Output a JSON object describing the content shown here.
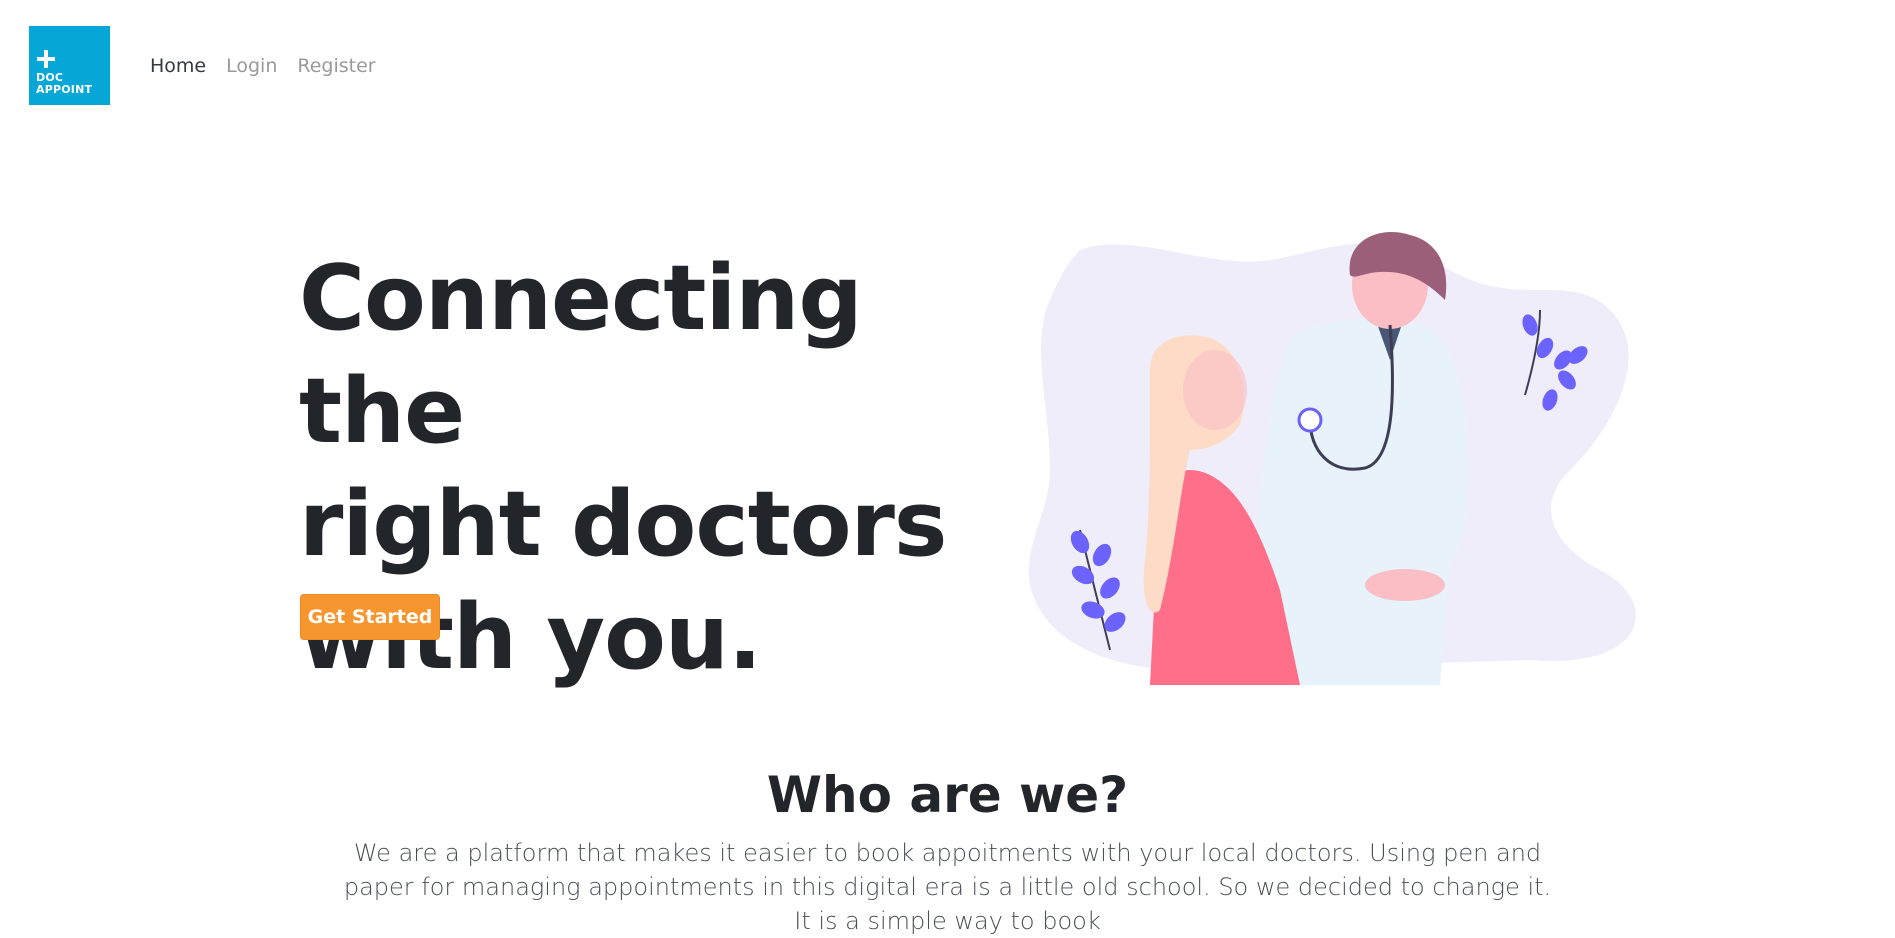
{
  "brand": {
    "logo_icon": "plus-icon",
    "logo_text_line1": "DOC",
    "logo_text_line2": "APPOINT",
    "accent_color": "#06a7d6"
  },
  "nav": {
    "items": [
      {
        "label": "Home",
        "active": true
      },
      {
        "label": "Login",
        "active": false
      },
      {
        "label": "Register",
        "active": false
      }
    ]
  },
  "hero": {
    "title": "Connecting the\nright doctors\nwith you.",
    "cta_label": "Get Started",
    "cta_color": "#f7962e"
  },
  "about": {
    "title": "Who are we?",
    "text": "We are a platform that makes it easier to book appoitments with your local doctors. Using pen and paper for managing appointments in this digital era is a little old school. So we decided to change it. It is a simple way to book"
  }
}
